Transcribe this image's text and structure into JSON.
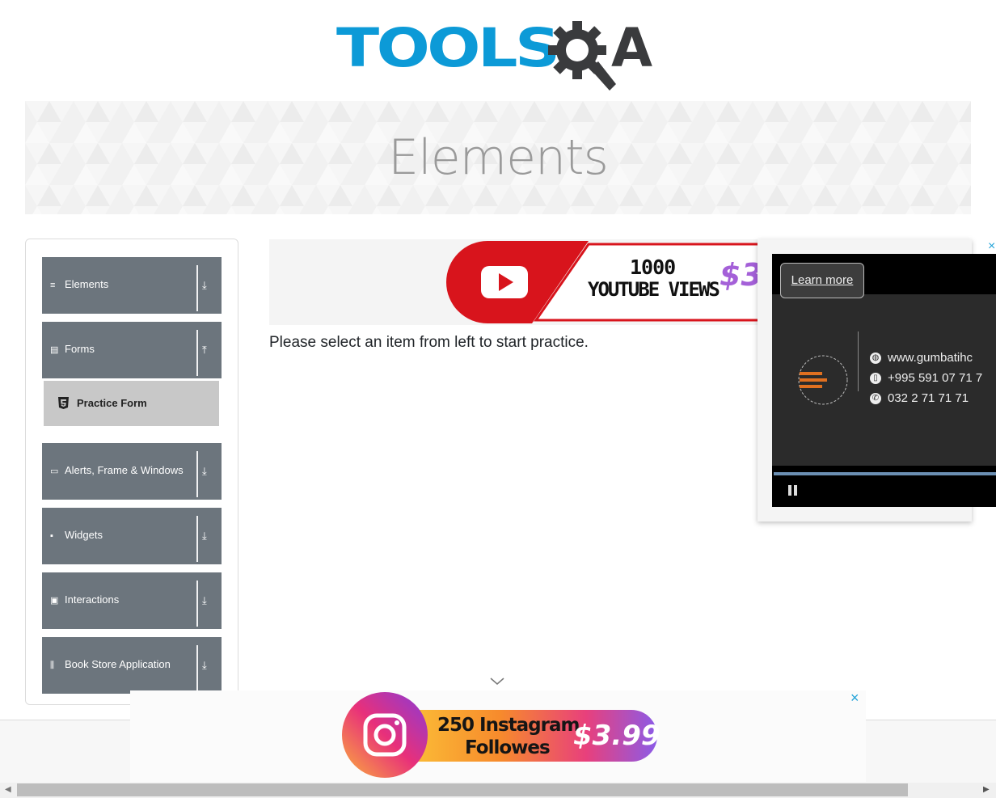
{
  "logo": {
    "brand_blue": "TOOLS",
    "brand_dark": "A",
    "colors": {
      "blue": "#0c9ad7",
      "dark": "#3a3b3d"
    }
  },
  "header": {
    "title": "Elements"
  },
  "sidebar": {
    "groups": [
      {
        "label": "Elements",
        "icon": "list-icon",
        "arrow": "⤓"
      },
      {
        "label": "Forms",
        "icon": "document-icon",
        "arrow": "⤒"
      },
      {
        "label": "Alerts, Frame & Windows",
        "icon": "window-icon",
        "arrow": "⤓"
      },
      {
        "label": "Widgets",
        "icon": "grid-icon",
        "arrow": "⤓"
      },
      {
        "label": "Interactions",
        "icon": "cursor-box-icon",
        "arrow": "⤓"
      },
      {
        "label": "Book Store Application",
        "icon": "books-icon",
        "arrow": "⤓"
      }
    ],
    "forms_subitems": [
      {
        "label": "Practice Form",
        "icon": "html5-icon"
      }
    ]
  },
  "main": {
    "instruction": "Please select an item from left to start practice."
  },
  "ads": {
    "youtube": {
      "line1": "1000",
      "line2": "YOUTUBE VIEWS",
      "price": "$3."
    },
    "video": {
      "learn_more": "Learn more",
      "website": "www.gumbatihc",
      "mobile": "+995 591 07 71 7",
      "phone": "032 2 71 71 71",
      "close": "×"
    },
    "instagram": {
      "line1": "250 Instagram",
      "line2": "Followes",
      "price": "$3.99",
      "close": "×"
    }
  }
}
